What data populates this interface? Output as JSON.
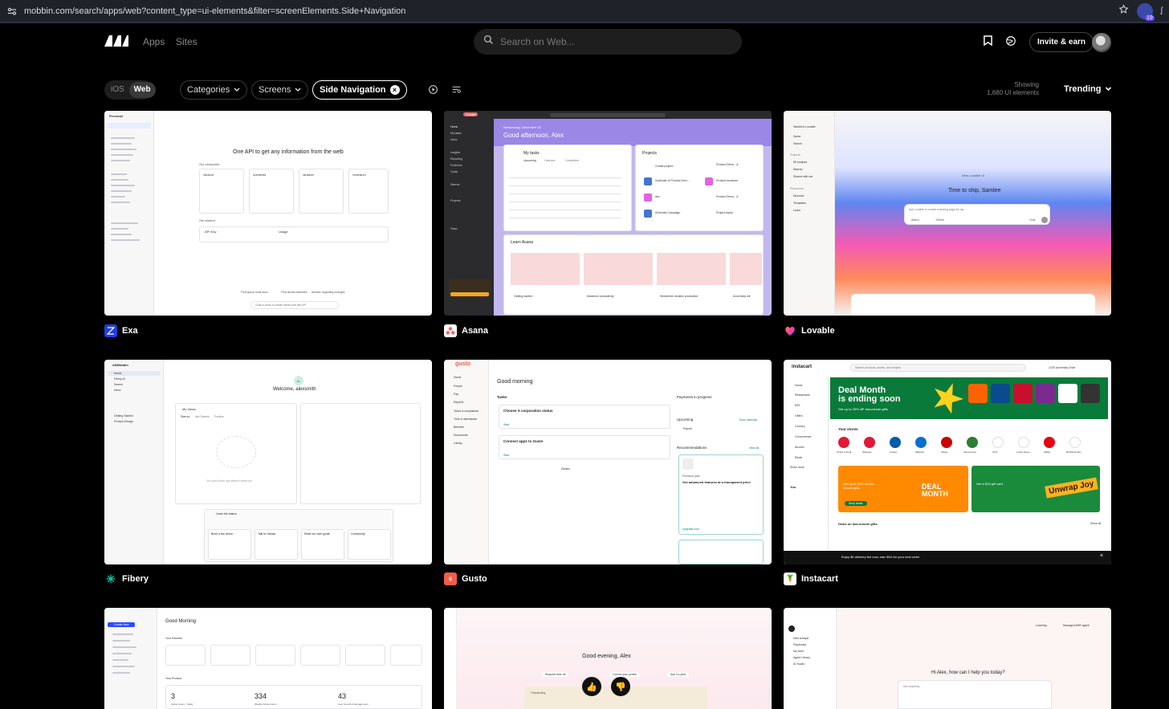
{
  "browser": {
    "url": "mobbin.com/search/apps/web?content_type=ui-elements&filter=screenElements.Side+Navigation",
    "extension_count": "19"
  },
  "header": {
    "nav": [
      "Apps",
      "Sites"
    ],
    "search_placeholder": "Search on Web...",
    "invite_label": "Invite & earn"
  },
  "filters": {
    "platforms": [
      "iOS",
      "Web"
    ],
    "active_platform": "Web",
    "categories_label": "Categories",
    "screens_label": "Screens",
    "active_filter": "Side Navigation",
    "showing_label": "Showing",
    "showing_count": "1,680 UI elements",
    "sort_label": "Trending"
  },
  "cards": [
    {
      "app": "Exa",
      "icon_color": "#1f3fe0",
      "texts": {
        "workspace": "Personal",
        "headline": "One API to get any information from the web",
        "endpoints": "Our endpoints",
        "cols": [
          "/search",
          "/contents",
          "/answer",
          "/research"
        ],
        "get_started": "Get started",
        "api_key": "API Key",
        "usage": "Usage",
        "footer_links": [
          "Find specs tools docs",
          "Find similar websites",
          "Answer regarding changes"
        ],
        "ask": "Chat to tools to create ideas with the API"
      }
    },
    {
      "app": "Asana",
      "icon_color": "#f06a6a",
      "texts": {
        "create": "Create",
        "date": "Wednesday, December 31",
        "greeting": "Good afternoon, Alex",
        "my_tasks": "My tasks",
        "tabs": [
          "Upcoming",
          "Overdue",
          "Completed"
        ],
        "projects": "Projects",
        "project_items": [
          "Create project",
          "Product Demo - A",
          "Duplicate of Product Dem...",
          "Product launches",
          "abc",
          "Product Demo - A",
          "ASAnalia Campaign",
          "Project Alpha"
        ],
        "learn": "Learn Asana",
        "learn_items": [
          "Getting started",
          "Maximize productivity",
          "Streamline creative production",
          "Avoid step wit"
        ],
        "sidebar": [
          "Home",
          "My tasks",
          "Inbox",
          "Insights",
          "Reporting",
          "Portfolios",
          "Goals",
          "Starred",
          "Projects",
          "Team"
        ]
      }
    },
    {
      "app": "Lovable",
      "icon_color": "#ff4f9a",
      "texts": {
        "workspace": "Samlee's Lovable",
        "new_label": "New Lovable UI",
        "headline": "Time to ship, Samlee",
        "prompt": "Ask Lovable to create a landing page for my...",
        "attach": "Attach",
        "theme": "Theme",
        "chat": "Chat",
        "sidebar": [
          "Home",
          "Search",
          "Projects",
          "All projects",
          "Starred",
          "Shared with me",
          "Resources",
          "Discover",
          "Templates",
          "Learn"
        ]
      }
    },
    {
      "app": "Fibery",
      "icon_color": "#18c1a0",
      "texts": {
        "workspace": "ASMobbin",
        "greeting": "Welcome, alexsmith",
        "avatar": "AL",
        "my_views": "My Views",
        "tabs": [
          "Starred",
          "Are Games",
          "Folders"
        ],
        "empty": "You don't have any starred views yet",
        "learn_basics": "Learn the basics",
        "learn_cards": [
          "Book a live demo",
          "Talk to Human",
          "Read our user guide",
          "Community"
        ],
        "sidebar": [
          "Home",
          "Fibery AI",
          "Search",
          "Inbox",
          "Getting Started",
          "Product Design"
        ]
      }
    },
    {
      "app": "Gusto",
      "icon_color": "#f45d48",
      "texts": {
        "brand": "gusto",
        "greeting": "Good morning",
        "tasks": "Tasks",
        "task1": "Choose S corporation status",
        "task2": "Connect apps to Gusto",
        "start": "Start",
        "payments": "Payments in progress",
        "upcoming": "Upcoming",
        "sync": "Sync calendar",
        "payroll": "Payroll",
        "recs": "Recommendations",
        "view_all": "View all",
        "premium": "Premium plan",
        "rec_title": "Get advanced features at a transparent price",
        "upgrade": "Upgrade now",
        "footer": "Gusto",
        "sidebar": [
          "Home",
          "People",
          "Pay",
          "Reports",
          "Taxes & compliance",
          "Time & attendance",
          "Benefits",
          "Documents",
          "Library"
        ]
      }
    },
    {
      "app": "Instacart",
      "icon_color": "#ff7009",
      "texts": {
        "brand": "instacart",
        "search": "Search products, stores, and recipes",
        "address": "1225 University Drive",
        "hero_title1": "Deal Month",
        "hero_title2": "is ending soon",
        "hero_sub": "Get up to 25% off* last-minute gifts",
        "stores_title": "Your stores",
        "stores": [
          "Smart & Final",
          "Safeway",
          "Costco",
          "Walmart",
          "Target",
          "Sprouts Far...",
          "CVS",
          "Lucky Super...",
          "HMart",
          "99 Ranch Ma..."
        ],
        "promo1": "Get up to 25% off last-minute gifts",
        "promo1_big": "DEAL MONTH",
        "promo2": "Get a $15 gift card",
        "promo2_big": "Unwrap Joy",
        "shop": "Shop deals",
        "deals_title": "Deals on last-minute gifts",
        "show_all": "Show all",
        "banner": "Enjoy $0 delivery fee now, earn $10 for your next order",
        "sidebar": [
          "Home",
          "Restaurants",
          "EBT",
          "Offers",
          "Grocery",
          "Convenience",
          "Alcohol",
          "Retail",
          "Show more"
        ],
        "you": "You"
      }
    },
    {
      "app": "",
      "icon_color": "#2a4bff",
      "texts": {
        "greeting": "Good Morning",
        "recents": "Your Recents",
        "product": "Your Product",
        "stats": [
          "3",
          "334",
          "43"
        ],
        "stat_labels": [
          "Active Users - Today",
          "Weekly Active Users",
          "User Growth & Engagement"
        ],
        "create": "Create New"
      }
    },
    {
      "app": "",
      "icon_color": "#888888",
      "texts": {
        "greeting": "Good evening, Alex",
        "chips": [
          "Request time off",
          "Correct your profile",
          "Ask Co-pilot"
        ],
        "onboarding": "Onboarding"
      }
    },
    {
      "app": "",
      "icon_color": "#222222",
      "texts": {
        "greeting": "Hi Alex, how can I help you today?",
        "placeholder": "Ask anything...",
        "top_right": [
          "Learning",
          "Manage AI/HR agent"
        ],
        "sidebar": [
          "New Analyst",
          "Playbooks",
          "My work",
          "Agent Library",
          "AI Studio"
        ]
      }
    }
  ]
}
